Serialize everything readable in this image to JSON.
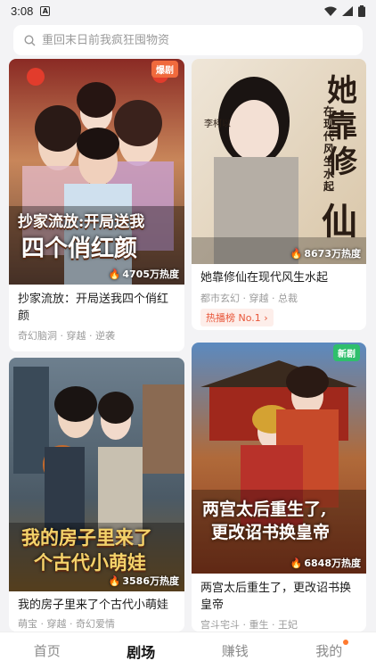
{
  "status_bar": {
    "time": "3:08",
    "sim_label": "A"
  },
  "search": {
    "placeholder": "重回末日前我疯狂囤物资"
  },
  "cards": [
    {
      "title": "抄家流放：开局送我四个俏红颜",
      "tags": "奇幻脑洞 · 穿越 · 逆袭",
      "heat": "4705万热度",
      "badge": "爆剧",
      "poster_text": [
        "抄家流放:开局送我",
        "四个俏红颜"
      ]
    },
    {
      "title": "她靠修仙在现代风生水起",
      "tags": "都市玄幻 · 穿越 · 总裁",
      "heat": "8673万热度",
      "rank": "热播榜 No.1 ›",
      "poster_text_big": [
        "她",
        "靠",
        "修",
        "仙"
      ],
      "poster_text_small": "在现代风生水起",
      "poster_actor": "李柯以"
    },
    {
      "title": "我的房子里来了个古代小萌娃",
      "tags": "萌宝 · 穿越 · 奇幻爱情",
      "heat": "3586万热度",
      "poster_text": [
        "我的房子里来了",
        "个古代小萌娃"
      ]
    },
    {
      "title": "两宫太后重生了，更改诏书换皇帝",
      "tags": "宫斗宅斗 · 重生 · 王妃",
      "heat": "6848万热度",
      "badge": "新剧",
      "poster_text": [
        "两宫太后重生了,",
        "更改诏书换皇帝"
      ]
    }
  ],
  "tabs": [
    {
      "label": "首页",
      "active": false
    },
    {
      "label": "剧场",
      "active": true
    },
    {
      "label": "赚钱",
      "active": false
    },
    {
      "label": "我的",
      "active": false,
      "dot": true
    }
  ],
  "colors": {
    "hot_badge": "#f06a3d",
    "new_badge": "#2fbf6c",
    "rank_text": "#e8573a",
    "dot": "#ff7a2f"
  }
}
